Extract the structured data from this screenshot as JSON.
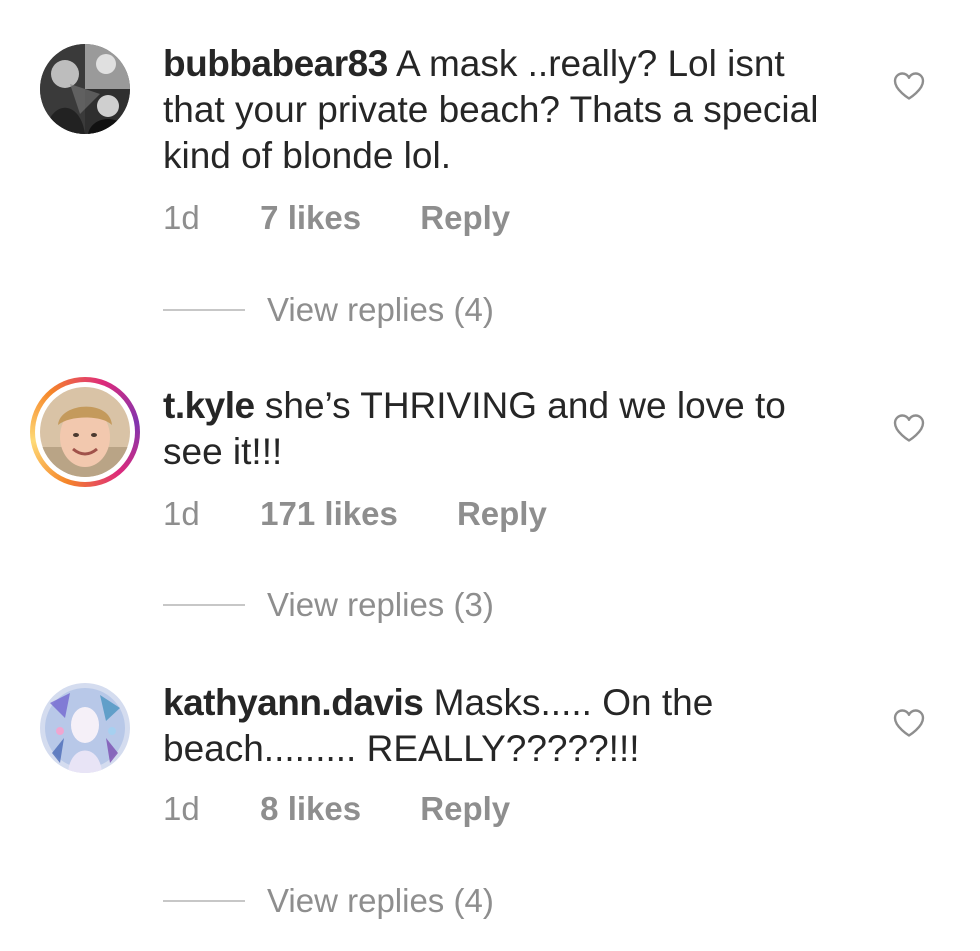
{
  "comments": [
    {
      "username": "bubbabear83",
      "text": "A mask ..really? Lol isnt that your private beach? Thats a special kind of blonde lol.",
      "time": "1d",
      "likes": "7 likes",
      "reply_label": "Reply",
      "view_replies": "View replies (4)"
    },
    {
      "username": "t.kyle",
      "text": "she’s THRIVING and we love to see it!!!",
      "time": "1d",
      "likes": "171 likes",
      "reply_label": "Reply",
      "view_replies": "View replies (3)"
    },
    {
      "username": "kathyann.davis",
      "text": "Masks..... On the beach......... REALLY?????!!!",
      "time": "1d",
      "likes": "8 likes",
      "reply_label": "Reply",
      "view_replies": "View replies (4)"
    }
  ],
  "icons": {
    "like": "heart-icon"
  },
  "colors": {
    "text": "#262626",
    "secondary": "#8e8e8e",
    "story_ring_start": "#feda77",
    "story_ring_end": "#dd2a7b"
  }
}
